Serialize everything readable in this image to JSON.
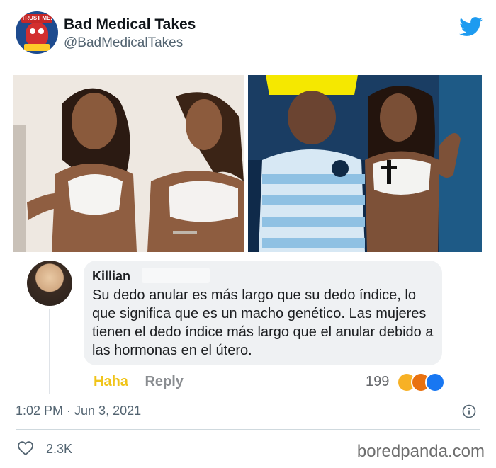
{
  "tweet": {
    "author_name": "Bad Medical Takes",
    "author_handle": "@BadMedicalTakes",
    "avatar_badge_text": "TRUST ME.",
    "time": "1:02 PM · Jun 3, 2021",
    "likes": "2.3K"
  },
  "comment": {
    "author": "Killian",
    "text": "Su dedo anular es más largo que su dedo índice, lo que significa que es un macho genético. Las mujeres tienen el dedo índice más largo que el anular debido a las hormonas en el útero.",
    "haha_label": "Haha",
    "reply_label": "Reply",
    "reaction_count": "199"
  },
  "watermark": "boredpanda.com",
  "icons": {
    "brand": "twitter-bird-icon",
    "info": "info-icon",
    "like": "heart-icon",
    "reactions": [
      "haha-icon",
      "angry-icon",
      "like-icon"
    ]
  },
  "colors": {
    "twitter_blue": "#1d9bf0",
    "haha_yellow": "#f0c419"
  }
}
